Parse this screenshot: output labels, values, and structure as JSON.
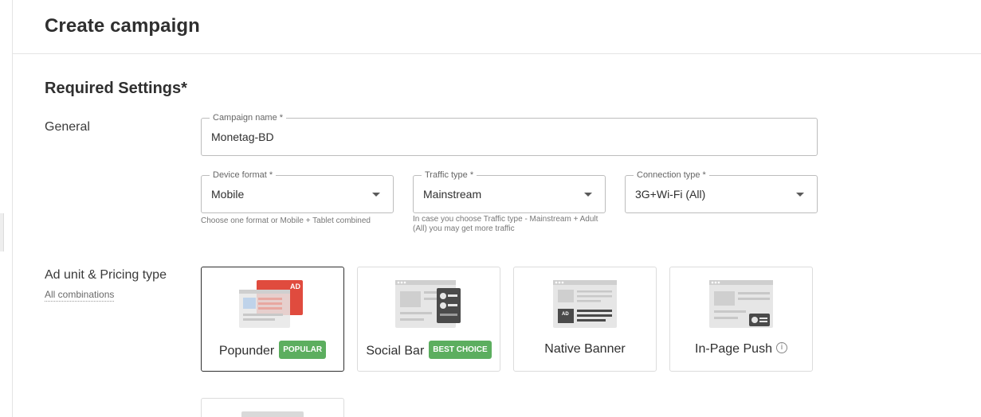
{
  "page": {
    "title": "Create campaign"
  },
  "section": {
    "title": "Required Settings*"
  },
  "general": {
    "label": "General",
    "campaign_name": {
      "label": "Campaign name *",
      "value": "Monetag-BD"
    },
    "device_format": {
      "label": "Device format *",
      "value": "Mobile",
      "helper": "Choose one format or Mobile + Tablet combined"
    },
    "traffic_type": {
      "label": "Traffic type *",
      "value": "Mainstream",
      "helper_line1": "In case you choose Traffic type - Mainstream + Adult",
      "helper_line2": "(All) you may get more traffic"
    },
    "connection_type": {
      "label": "Connection type *",
      "value": "3G+Wi-Fi (All)"
    }
  },
  "ad_unit": {
    "label": "Ad unit & Pricing type",
    "sublink": "All combinations",
    "cards": [
      {
        "name": "Popunder",
        "badge": "POPULAR",
        "selected": true
      },
      {
        "name": "Social Bar",
        "badge": "BEST CHOICE",
        "selected": false
      },
      {
        "name": "Native Banner",
        "badge": "",
        "selected": false
      },
      {
        "name": "In-Page Push",
        "badge": "",
        "selected": false,
        "info": "i"
      }
    ],
    "ad_tag": "AD"
  },
  "colors": {
    "badge_green": "#5cae5f",
    "ad_red": "#e04b3e",
    "selected_border": "#2f2f2f"
  }
}
